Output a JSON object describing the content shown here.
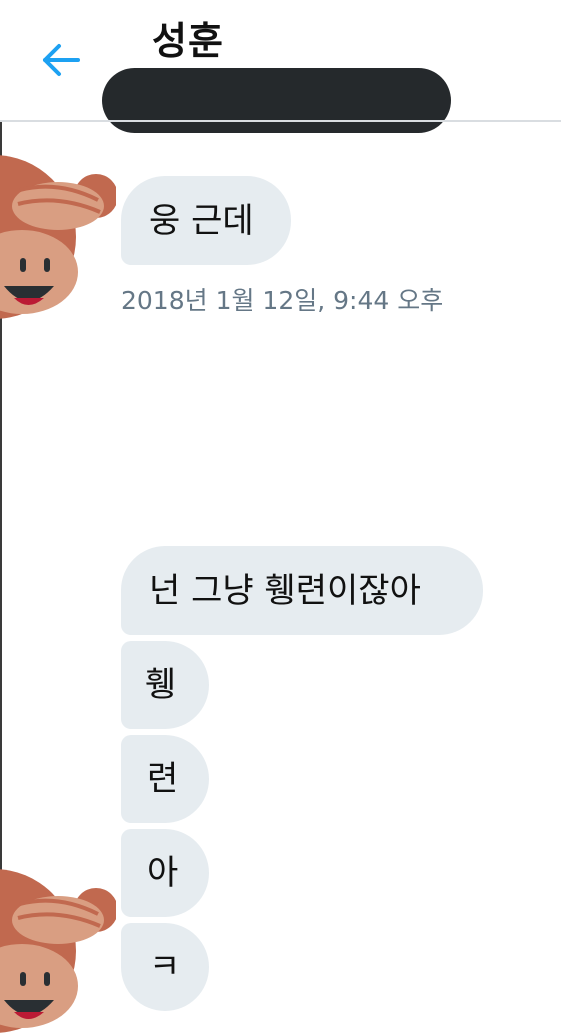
{
  "header": {
    "contact_name": "성훈"
  },
  "messages": [
    {
      "text": "웅 근데"
    },
    {
      "timestamp": "2018년 1월 12일, 9:44 오후"
    },
    {
      "text": "넌 그냥 휑련이잖아"
    },
    {
      "text": "휑"
    },
    {
      "text": "련"
    },
    {
      "text": "아"
    },
    {
      "text": "ㅋ"
    }
  ],
  "icons": {
    "back": "arrow-left-icon",
    "avatar": "see-no-evil-monkey-avatar"
  },
  "colors": {
    "accent": "#1da1f2",
    "bubble": "#e6ecf0",
    "timestamp": "#657786",
    "redaction": "#25292c"
  }
}
